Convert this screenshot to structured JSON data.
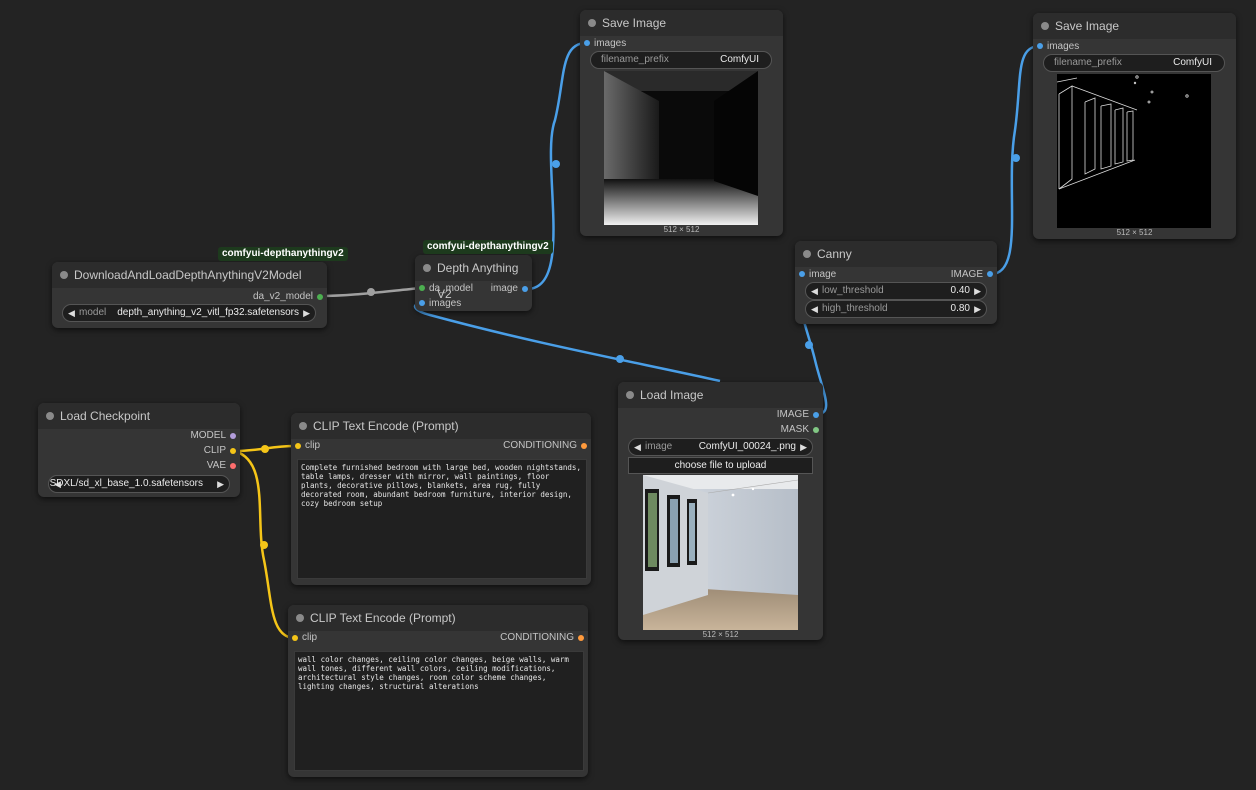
{
  "nodes": {
    "depth_loader": {
      "badge": "comfyui-depthanythingv2",
      "title": "DownloadAndLoadDepthAnythingV2Model",
      "output": "da_v2_model",
      "widget_label": "model",
      "widget_value": "depth_anything_v2_vitl_fp32.safetensors"
    },
    "depth_anything": {
      "badge": "comfyui-depthanythingv2",
      "title": "Depth Anything V2",
      "input1": "da_model",
      "input2": "images",
      "output": "image"
    },
    "save1": {
      "title": "Save Image",
      "input": "images",
      "widget_label": "filename_prefix",
      "widget_value": "ComfyUI",
      "caption": "512 × 512"
    },
    "save2": {
      "title": "Save Image",
      "input": "images",
      "widget_label": "filename_prefix",
      "widget_value": "ComfyUI",
      "caption": "512 × 512"
    },
    "canny": {
      "title": "Canny",
      "input": "image",
      "output": "IMAGE",
      "low_label": "low_threshold",
      "low_value": "0.40",
      "high_label": "high_threshold",
      "high_value": "0.80"
    },
    "load_image": {
      "title": "Load Image",
      "out1": "IMAGE",
      "out2": "MASK",
      "widget_label": "image",
      "widget_value": "ComfyUI_00024_.png",
      "button": "choose file to upload",
      "caption": "512 × 512"
    },
    "checkpoint": {
      "title": "Load Checkpoint",
      "out1": "MODEL",
      "out2": "CLIP",
      "out3": "VAE",
      "widget_value": "SDXL/sd_xl_base_1.0.safetensors"
    },
    "clip1": {
      "title": "CLIP Text Encode (Prompt)",
      "input": "clip",
      "output": "CONDITIONING",
      "text": "Complete furnished bedroom with large bed, wooden nightstands, table lamps, dresser with mirror, wall paintings, floor plants, decorative pillows, blankets, area rug, fully decorated room, abundant bedroom furniture, interior design, cozy bedroom setup"
    },
    "clip2": {
      "title": "CLIP Text Encode (Prompt)",
      "input": "clip",
      "output": "CONDITIONING",
      "text": "wall color changes, ceiling color changes, beige walls, warm wall tones, different wall colors, ceiling modifications, architectural style changes, room color scheme changes, lighting changes, structural alterations"
    }
  },
  "colors": {
    "image_link": "#4a9fe8",
    "clip_link": "#f5c518",
    "model_link": "#a0a0a0",
    "model_slot": "#b39ddb",
    "vae_slot": "#ff6e6e",
    "da_slot": "#4caf50",
    "mask_slot": "#81c784"
  }
}
